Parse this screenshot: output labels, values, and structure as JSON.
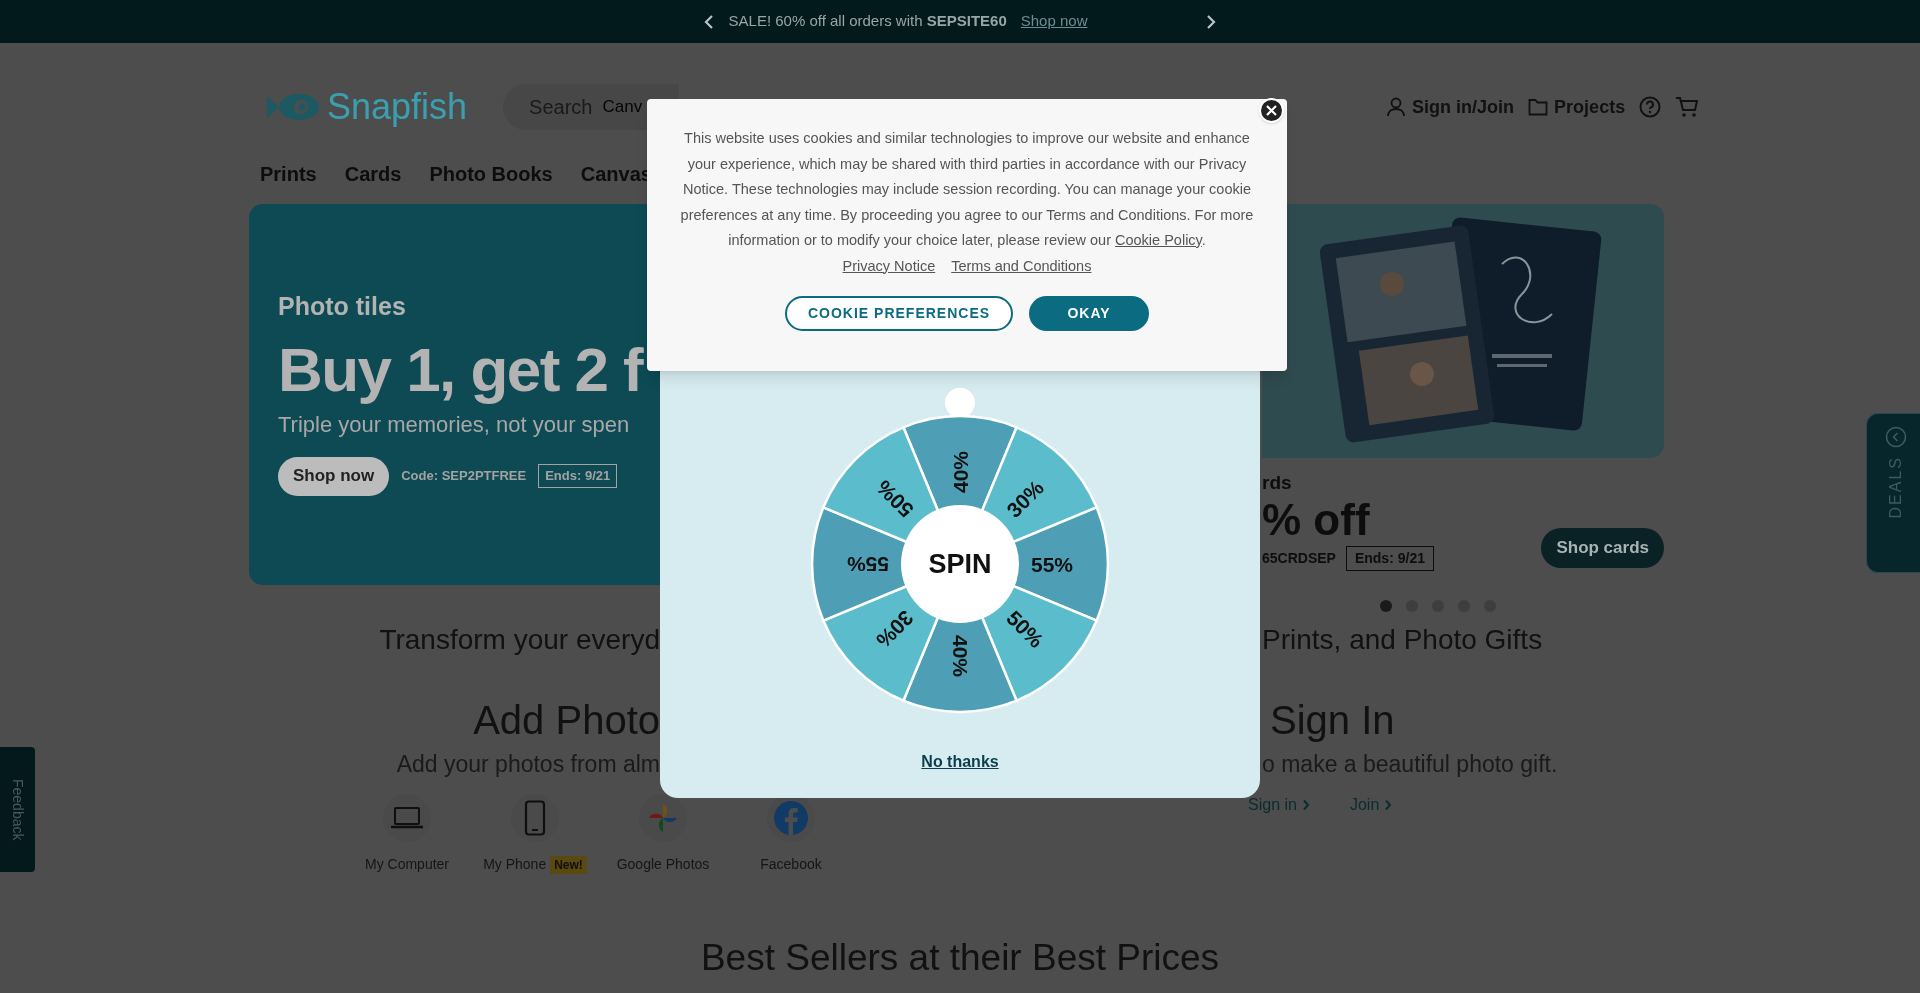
{
  "promo_banner": {
    "message": "SALE! 60% off all orders with **SEPSITE60**",
    "link": "Shop now"
  },
  "header": {
    "logo": "Snapfish",
    "search": {
      "label": "Search",
      "value": "Canv"
    },
    "actions": [
      {
        "kind": "account",
        "label": "Sign in/Join"
      },
      {
        "kind": "projects",
        "label": "Projects"
      }
    ]
  },
  "nav": [
    "Prints",
    "Cards",
    "Photo Books",
    "Canvas"
  ],
  "hero_left": {
    "eyebrow": "Photo tiles",
    "headline": "Buy 1, get 2 f",
    "subtitle": "Triple your memories, not your spen",
    "button": "Shop now",
    "code": "Code: SEP2PTFREE",
    "ends": "Ends: 9/21"
  },
  "hero_right": {
    "eyebrow": "rds",
    "headline": "% off",
    "code": "65CRDSEP",
    "ends": "Ends: 9/21",
    "button": "Shop cards"
  },
  "carousel_dots": [
    {
      "selected": true
    },
    {
      "selected": false
    },
    {
      "selected": false
    },
    {
      "selected": false
    },
    {
      "selected": false
    }
  ],
  "tagline_left": "Transform your everyd",
  "tagline_right": "Prints, and Photo Gifts",
  "add_photos": {
    "title": "Add Photo",
    "subtitle": "Add your photos from alm",
    "sources": [
      {
        "kind": "computer",
        "label": "My Computer"
      },
      {
        "kind": "phone",
        "label": "My Phone",
        "badge": "New!"
      },
      {
        "kind": "google_photos",
        "label": "Google Photos"
      },
      {
        "kind": "facebook",
        "label": "Facebook"
      }
    ]
  },
  "sign_in": {
    "title": "Sign In",
    "subtitle": "o make a beautiful photo gift.",
    "links": [
      "Sign in",
      "Join"
    ]
  },
  "best_sellers_title": "Best Sellers at their Best Prices",
  "deals_tab": "DEALS",
  "feedback_tab": "Feedback",
  "spin_dialog": {
    "segments": [
      {
        "label": "40%",
        "color": "#4e9fb5"
      },
      {
        "label": "30%",
        "color": "#5bbdcc"
      },
      {
        "label": "55%",
        "color": "#4e9fb5"
      },
      {
        "label": "50%",
        "color": "#5bbdcc"
      },
      {
        "label": "40%",
        "color": "#4e9fb5"
      },
      {
        "label": "30%",
        "color": "#5bbdcc"
      },
      {
        "label": "55%",
        "color": "#4e9fb5"
      },
      {
        "label": "50%",
        "color": "#5bbdcc"
      }
    ],
    "spin": "SPIN",
    "dismiss": "No thanks"
  },
  "cookie_dialog": {
    "text": "This website uses cookies and similar technologies to improve our website and enhance your experience, which may be shared with third parties in accordance with our Privacy Notice. These technologies may include session recording. You can manage your cookie preferences at any time. By proceeding you agree to our Terms and Conditions. For more information or to modify your choice later, please review our",
    "policy_link": "Cookie Policy",
    "text_end": ".",
    "links": [
      "Privacy Notice",
      "Terms and Conditions"
    ],
    "buttons": [
      {
        "kind": "outline",
        "label": "COOKIE PREFERENCES"
      },
      {
        "kind": "primary",
        "label": "OKAY"
      }
    ]
  }
}
